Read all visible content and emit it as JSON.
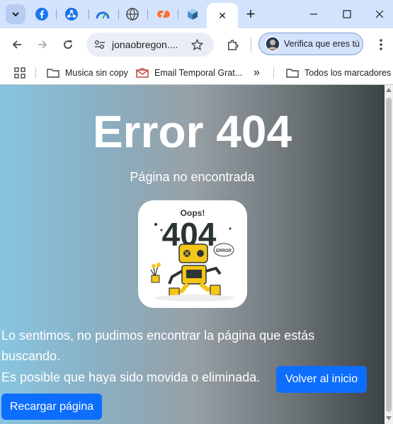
{
  "browser": {
    "address": "jonaobregon....",
    "verify_label": "Verifica que eres tú",
    "bookmarks": [
      {
        "label": "Musica sin copy"
      },
      {
        "label": "Email Temporal Grat..."
      },
      {
        "label": "Todos los marcadores"
      }
    ],
    "overflow_glyph": "»",
    "close_glyph": "✕",
    "new_tab_glyph": "+"
  },
  "page": {
    "title": "Error 404",
    "subtitle": "Página no encontrada",
    "illustration_text": {
      "oops": "Oops!",
      "code": "404",
      "error": "ERROR"
    },
    "message_line1": "Lo sentimos, no pudimos encontrar la página que estás buscando.",
    "message_line2": "Es posible que haya sido movida o eliminada.",
    "home_button": "Volver al inicio",
    "reload_button": "Recargar página"
  },
  "colors": {
    "tabstrip": "#d3e3fd",
    "button_primary": "#0d6efd",
    "gradient_start": "#87c5e0",
    "gradient_end": "#3b4245"
  }
}
